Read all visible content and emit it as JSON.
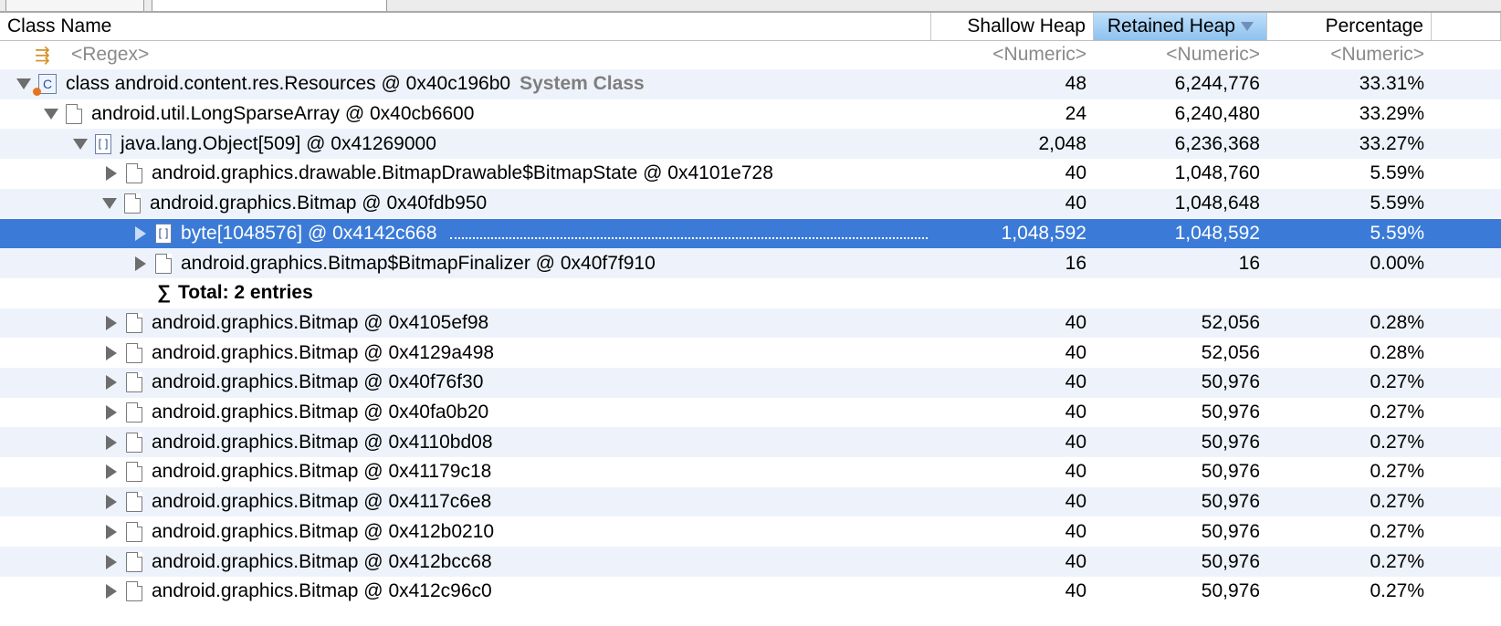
{
  "header": {
    "col_name": "Class Name",
    "col_shallow": "Shallow Heap",
    "col_retained": "Retained Heap",
    "col_pct": "Percentage"
  },
  "filter": {
    "name": "<Regex>",
    "shallow": "<Numeric>",
    "retained": "<Numeric>",
    "pct": "<Numeric>"
  },
  "rows": [
    {
      "label": "class android.content.res.Resources @ 0x40c196b0",
      "suffix": "System Class",
      "shallow": "48",
      "retained": "6,244,776",
      "pct": "33.31%"
    },
    {
      "label": "android.util.LongSparseArray @ 0x40cb6600",
      "shallow": "24",
      "retained": "6,240,480",
      "pct": "33.29%"
    },
    {
      "label": "java.lang.Object[509] @ 0x41269000",
      "shallow": "2,048",
      "retained": "6,236,368",
      "pct": "33.27%"
    },
    {
      "label": "android.graphics.drawable.BitmapDrawable$BitmapState @ 0x4101e728",
      "shallow": "40",
      "retained": "1,048,760",
      "pct": "5.59%"
    },
    {
      "label": "android.graphics.Bitmap @ 0x40fdb950",
      "shallow": "40",
      "retained": "1,048,648",
      "pct": "5.59%"
    },
    {
      "label": "byte[1048576] @ 0x4142c668",
      "shallow": "1,048,592",
      "retained": "1,048,592",
      "pct": "5.59%"
    },
    {
      "label": "android.graphics.Bitmap$BitmapFinalizer @ 0x40f7f910",
      "shallow": "16",
      "retained": "16",
      "pct": "0.00%"
    },
    {
      "label": "Total: 2 entries"
    },
    {
      "label": "android.graphics.Bitmap @ 0x4105ef98",
      "shallow": "40",
      "retained": "52,056",
      "pct": "0.28%"
    },
    {
      "label": "android.graphics.Bitmap @ 0x4129a498",
      "shallow": "40",
      "retained": "52,056",
      "pct": "0.28%"
    },
    {
      "label": "android.graphics.Bitmap @ 0x40f76f30",
      "shallow": "40",
      "retained": "50,976",
      "pct": "0.27%"
    },
    {
      "label": "android.graphics.Bitmap @ 0x40fa0b20",
      "shallow": "40",
      "retained": "50,976",
      "pct": "0.27%"
    },
    {
      "label": "android.graphics.Bitmap @ 0x4110bd08",
      "shallow": "40",
      "retained": "50,976",
      "pct": "0.27%"
    },
    {
      "label": "android.graphics.Bitmap @ 0x41179c18",
      "shallow": "40",
      "retained": "50,976",
      "pct": "0.27%"
    },
    {
      "label": "android.graphics.Bitmap @ 0x4117c6e8",
      "shallow": "40",
      "retained": "50,976",
      "pct": "0.27%"
    },
    {
      "label": "android.graphics.Bitmap @ 0x412b0210",
      "shallow": "40",
      "retained": "50,976",
      "pct": "0.27%"
    },
    {
      "label": "android.graphics.Bitmap @ 0x412bcc68",
      "shallow": "40",
      "retained": "50,976",
      "pct": "0.27%"
    },
    {
      "label": "android.graphics.Bitmap @ 0x412c96c0",
      "shallow": "40",
      "retained": "50,976",
      "pct": "0.27%"
    }
  ],
  "colors": {
    "selection": "#3b7bd7",
    "alt_row": "#eef3fb",
    "sorted_header": "#8dc2ef"
  }
}
